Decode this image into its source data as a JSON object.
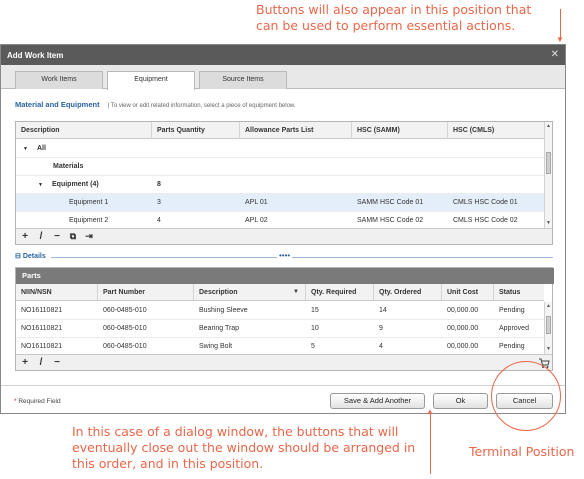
{
  "annotations": {
    "top": "Buttons will also appear in this position that can be used to perform essential actions.",
    "bottom": "In this case of a dialog window, the buttons that will eventually close out the window should be arranged in this order, and in this position.",
    "terminal": "Terminal Position"
  },
  "dialog": {
    "title": "Add Work Item",
    "close_glyph": "✕"
  },
  "tabs": [
    "Work Items",
    "Equipment",
    "Source Items"
  ],
  "section": {
    "title": "Material and Equipment",
    "subtitle": "|  To view or edit related information, select a piece of equipment below."
  },
  "equipment_table": {
    "columns": [
      "Description",
      "Parts Quantity",
      "Allowance Parts List",
      "HSC (SAMM)",
      "HSC (CMLS)"
    ],
    "rows": [
      {
        "desc": "All",
        "qty": "",
        "apl": "",
        "samm": "",
        "cmls": ""
      },
      {
        "desc": "Materials",
        "qty": "",
        "apl": "",
        "samm": "",
        "cmls": ""
      },
      {
        "desc": "Equipment (4)",
        "qty": "8",
        "apl": "",
        "samm": "",
        "cmls": ""
      },
      {
        "desc": "Equipment 1",
        "qty": "3",
        "apl": "APL 01",
        "samm": "SAMM HSC Code 01",
        "cmls": "CMLS HSC Code 01"
      },
      {
        "desc": "Equipment 2",
        "qty": "4",
        "apl": "APL 02",
        "samm": "SAMM HSC Code 02",
        "cmls": "CMLS HSC Code 02"
      }
    ]
  },
  "toolbar_glyphs": [
    "+",
    "/",
    "−",
    "⧉",
    "⇥"
  ],
  "details": {
    "label": "Details",
    "grip": "••••"
  },
  "parts_table": {
    "title": "Parts",
    "columns": [
      "NIIN/NSN",
      "Part Number",
      "Description",
      "Qty. Required",
      "Qty. Ordered",
      "Unit Cost",
      "Status"
    ],
    "sort_glyph": "▼",
    "rows": [
      {
        "niin": "NO16110821",
        "part": "060-0485-010",
        "desc": "Bushing Sleeve",
        "req": "15",
        "ord": "14",
        "cost": "00,000.00",
        "status": "Pending"
      },
      {
        "niin": "NO16110821",
        "part": "060-0485-010",
        "desc": "Bearing Trap",
        "req": "10",
        "ord": "9",
        "cost": "00,000.00",
        "status": "Approved"
      },
      {
        "niin": "NO16110821",
        "part": "060-0485-010",
        "desc": "Swing Bolt",
        "req": "5",
        "ord": "4",
        "cost": "00,000.00",
        "status": "Pending"
      }
    ]
  },
  "footer": {
    "required_star": "*",
    "required_label": "Required Field",
    "save_add": "Save & Add Another",
    "ok": "Ok",
    "cancel": "Cancel"
  },
  "colors": {
    "annotation": "#e8674a",
    "accent": "#2a64a0",
    "title_bar": "#5a5a5a"
  }
}
